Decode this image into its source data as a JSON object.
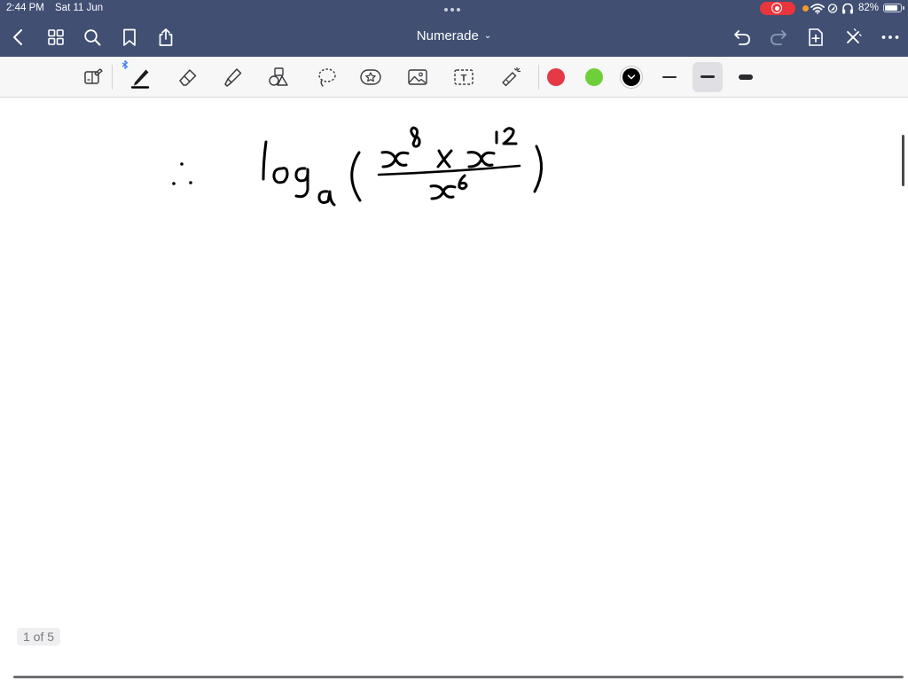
{
  "status_bar": {
    "time": "2:44 PM",
    "date": "Sat 11 Jun",
    "battery_percent": "82%",
    "battery_level": 0.82,
    "icons": [
      "screen-record-icon",
      "wifi-icon",
      "location-icon",
      "headphones-icon",
      "battery-icon"
    ]
  },
  "nav_bar": {
    "title": "Numerade",
    "title_caret": "⌄",
    "left_icons": [
      "back-icon",
      "grid-icon",
      "search-icon",
      "bookmark-icon",
      "share-icon"
    ],
    "right_icons": [
      "undo-icon",
      "redo-icon",
      "add-page-icon",
      "close-icon",
      "more-icon"
    ]
  },
  "toolbar": {
    "tools": [
      "read-only-icon",
      "pen-icon",
      "eraser-icon",
      "highlighter-icon",
      "shapes-icon",
      "lasso-icon",
      "sticker-icon",
      "image-icon",
      "text-icon",
      "laser-pointer-icon"
    ],
    "text_tool_glyph": "T",
    "selected_tool": "pen",
    "colors": [
      "#e63946",
      "#6fcf3a",
      "#000000"
    ],
    "selected_color": "#000000",
    "thickness_levels": [
      "thin",
      "medium",
      "thick"
    ],
    "selected_thickness": "medium",
    "accent": "#404f72"
  },
  "page": {
    "indicator": "1 of 5"
  }
}
